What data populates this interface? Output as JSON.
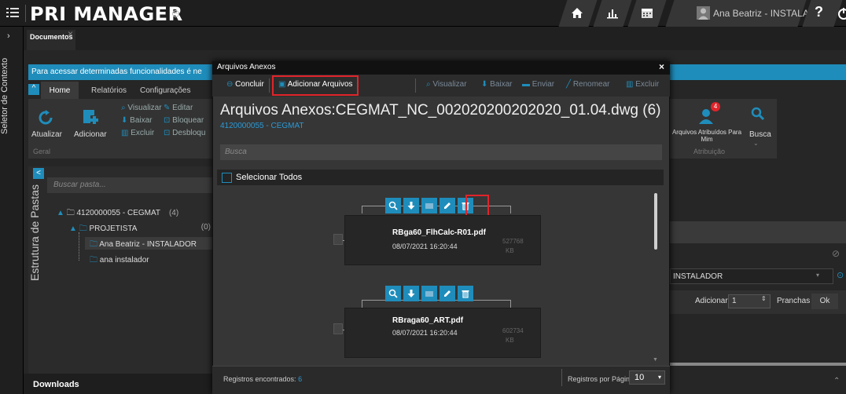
{
  "app": {
    "brand": "PRI MANAGER",
    "reg_mark": "R"
  },
  "topbar": {
    "user_name": "Ana Beatriz - INSTALADOR",
    "help": "?"
  },
  "context_selector": {
    "label": "Seletor de Contexto"
  },
  "doc_tab": {
    "label": "Documentos",
    "close": "×"
  },
  "info_bar": {
    "text": "Para acessar determinadas funcionalidades é ne"
  },
  "ribbon": {
    "toggle": "^",
    "tabs": [
      "Home",
      "Relatórios",
      "Configurações"
    ],
    "buttons": {
      "refresh": "Atualizar",
      "add": "Adicionar"
    },
    "small": {
      "view": "Visualizar",
      "edit": "Editar",
      "download": "Baixar",
      "lock": "Bloquear",
      "delete": "Excluir",
      "unlock": "Desbloqu"
    },
    "group": "Geral"
  },
  "folders": {
    "panel_label": "Estrutura de Pastas",
    "collapse": "<",
    "search_placeholder": "Buscar pasta...",
    "tree": [
      {
        "label": "4120000055 - CEGMAT",
        "count": "(4)"
      },
      {
        "label": "PROJETISTA",
        "count": "(0)"
      },
      {
        "label": "Ana Beatriz - INSTALADOR",
        "count": ""
      },
      {
        "label": "ana instalador",
        "count": ""
      }
    ]
  },
  "right_panel": {
    "assigned": "Arquivos Atribuídos Para Mim",
    "assigned_badge": "4",
    "search": "Busca",
    "group": "Atribuição",
    "combo_value": "INSTALADOR",
    "add_label": "Adicionar",
    "add_value": "1",
    "sheets_label": "Pranchas",
    "ok": "Ok"
  },
  "downloads": {
    "label": "Downloads"
  },
  "dialog": {
    "title": "Arquivos Anexos",
    "close": "×",
    "toolbar": {
      "conclude": "Concluir",
      "add_files": "Adicionar Arquivos",
      "view": "Visualizar",
      "download": "Baixar",
      "send": "Enviar",
      "rename": "Renomear",
      "delete": "Excluir"
    },
    "heading": "Arquivos Anexos:CEGMAT_NC_002020200202020_01.04.dwg (6)",
    "subheading": "4120000055 - CEGMAT",
    "search_placeholder": "Busca",
    "select_all": "Selecionar Todos",
    "files": [
      {
        "name": "RBga60_FlhCalc-R01.pdf",
        "date": "08/07/2021 16:20:44",
        "size": "527768",
        "unit": "KB"
      },
      {
        "name": "RBraga60_ART.pdf",
        "date": "08/07/2021 16:20:44",
        "size": "602734",
        "unit": "KB"
      }
    ],
    "footer": {
      "records_label": "Registros encontrados:",
      "records_count": "6",
      "per_page_label": "Registros por Página",
      "per_page_value": "10"
    }
  },
  "colors": {
    "accent": "#1f8dbb",
    "highlight": "#e0242a",
    "badge": "#e0242a"
  }
}
